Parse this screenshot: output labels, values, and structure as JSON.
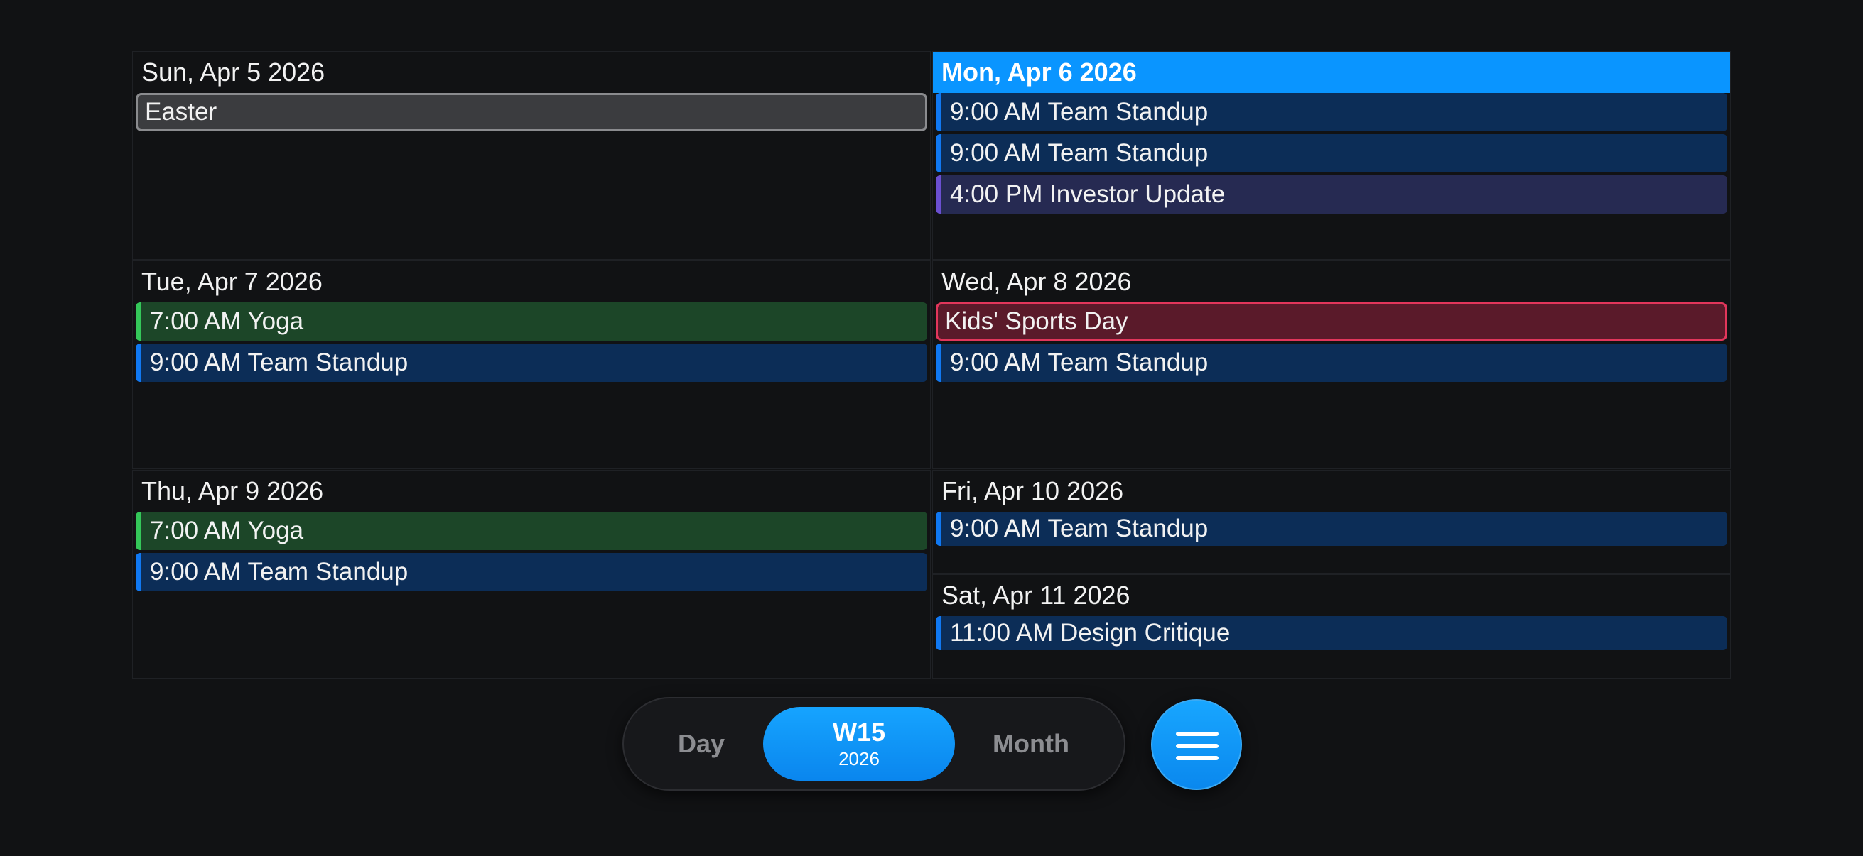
{
  "days": [
    {
      "header": "Sun, Apr 5 2026",
      "events": [
        {
          "title": "Easter"
        }
      ]
    },
    {
      "header": "Mon, Apr 6 2026",
      "today": true,
      "events": [
        {
          "title": "9:00 AM Team Standup"
        },
        {
          "title": "9:00 AM Team Standup"
        },
        {
          "title": "4:00 PM Investor Update"
        }
      ]
    },
    {
      "header": "Tue, Apr 7 2026",
      "events": [
        {
          "title": "7:00 AM Yoga"
        },
        {
          "title": "9:00 AM Team Standup"
        }
      ]
    },
    {
      "header": "Wed, Apr 8 2026",
      "events": [
        {
          "title": "Kids' Sports Day"
        },
        {
          "title": "9:00 AM Team Standup"
        }
      ]
    },
    {
      "header": "Thu, Apr 9 2026",
      "events": [
        {
          "title": "7:00 AM Yoga"
        },
        {
          "title": "9:00 AM Team Standup"
        }
      ]
    },
    {
      "header": "Fri, Apr 10 2026",
      "events": [
        {
          "title": "9:00 AM Team Standup"
        }
      ]
    },
    {
      "header": "Sat, Apr 11 2026",
      "events": [
        {
          "title": "11:00 AM Design Critique"
        }
      ]
    }
  ],
  "view_switcher": {
    "day_label": "Day",
    "week_label": "W15",
    "week_year": "2026",
    "month_label": "Month",
    "selected": "week"
  },
  "menu_icon": "hamburger-menu-icon",
  "colors": {
    "background": "#111214",
    "accent": "#0a95ff",
    "event_blue": "#0c2d57",
    "event_green": "#1c4628",
    "event_purple": "#262a52",
    "event_red": "#5a1a2a",
    "event_gray": "#3b3c3f"
  }
}
